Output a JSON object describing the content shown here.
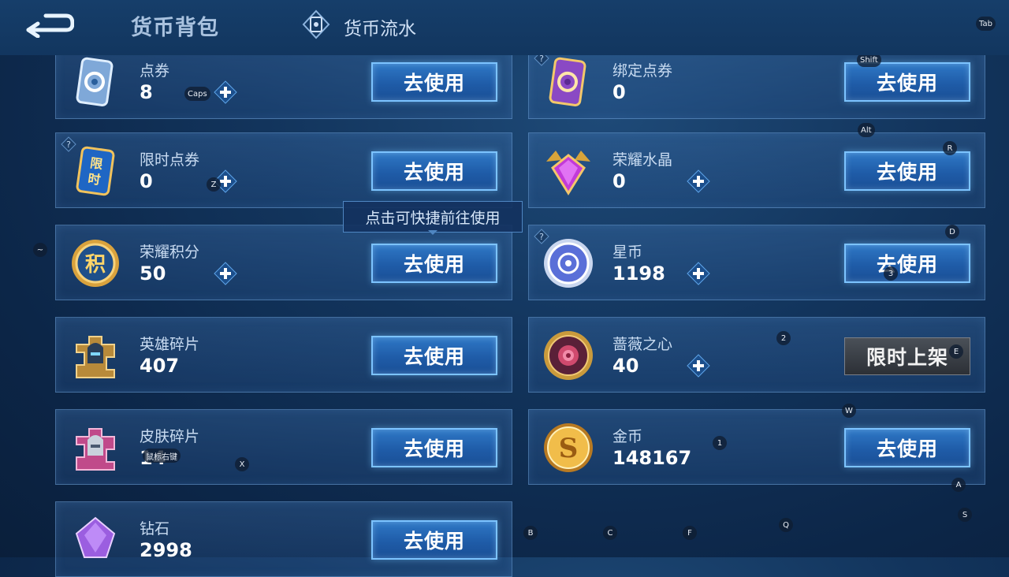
{
  "header": {
    "back_icon": "return-arrow-icon",
    "tab_wallet": "货币背包",
    "tab_flow": "货币流水",
    "tab_flow_icon": "diamond-frame-icon"
  },
  "tooltip": "点击可快捷前往使用",
  "buttons": {
    "use": "去使用",
    "limited": "限时上架"
  },
  "currencies": [
    {
      "name": "点券",
      "count": "8",
      "icon": "ticket-card-icon",
      "plus": true,
      "action": "use",
      "help": false
    },
    {
      "name": "绑定点券",
      "count": "0",
      "icon": "bound-ticket-card-icon",
      "plus": false,
      "action": "use",
      "help": true
    },
    {
      "name": "限时点券",
      "count": "0",
      "icon": "limited-ticket-icon",
      "plus": true,
      "action": "use",
      "help": true
    },
    {
      "name": "荣耀水晶",
      "count": "0",
      "icon": "glory-crystal-icon",
      "plus": true,
      "action": "use",
      "help": false
    },
    {
      "name": "荣耀积分",
      "count": "50",
      "icon": "glory-points-coin-icon",
      "plus": true,
      "action": "use",
      "help": false
    },
    {
      "name": "星币",
      "count": "1198",
      "icon": "star-coin-icon",
      "plus": true,
      "action": "use",
      "help": true
    },
    {
      "name": "英雄碎片",
      "count": "407",
      "icon": "hero-fragment-icon",
      "plus": false,
      "action": "use",
      "help": false
    },
    {
      "name": "蔷薇之心",
      "count": "40",
      "icon": "rose-heart-icon",
      "plus": true,
      "action": "limited",
      "help": false
    },
    {
      "name": "皮肤碎片",
      "count": "14",
      "icon": "skin-fragment-icon",
      "plus": false,
      "action": "use",
      "help": false
    },
    {
      "name": "金币",
      "count": "148167",
      "icon": "gold-coin-icon",
      "plus": false,
      "action": "use",
      "help": false
    },
    {
      "name": "钻石",
      "count": "2998",
      "icon": "diamond-gem-icon",
      "plus": false,
      "action": "use",
      "help": false
    }
  ],
  "key_overlays": [
    "Tab",
    "Shift",
    "Caps",
    "Alt",
    "R",
    "Z",
    "~",
    "D",
    "3",
    "2",
    "E",
    "W",
    "1",
    "X",
    "鼠标右键",
    "A",
    "S",
    "Q",
    "B",
    "C",
    "F"
  ],
  "colors": {
    "button_border": "#7cc3ff",
    "button_fill": "#1f5ca8",
    "background": "#12345c"
  }
}
